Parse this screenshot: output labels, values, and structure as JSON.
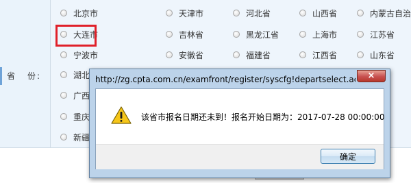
{
  "form": {
    "label_text": "省",
    "label_text2": "份:",
    "provinces": [
      "北京市",
      "天津市",
      "河北省",
      "山西省",
      "内蒙古自治区",
      "大连市",
      "吉林省",
      "黑龙江省",
      "上海市",
      "江苏省",
      "宁波市",
      "安徽省",
      "福建省",
      "江西省",
      "山东省",
      "湖北",
      "广西",
      "重庆",
      "新疆"
    ]
  },
  "dialog": {
    "title": "http://zg.cpta.com.cn/examfront/register/syscfg!departselect.action?...",
    "close_label": "×",
    "message": "该省市报名日期还未到！报名开始日期为：2017-07-28 00:00:00",
    "ok_label": "确定",
    "icon": "warning-icon"
  },
  "colors": {
    "panel_bg": "#eef5fc",
    "label_bg": "#eaf3fb",
    "highlight": "#e0202a",
    "dialog_frame": "#bcd3ea"
  }
}
